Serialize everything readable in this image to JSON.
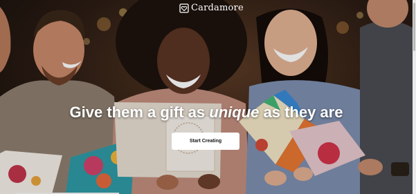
{
  "brand": {
    "name": "Cardamore",
    "logo_icon": "heart-card-icon"
  },
  "hero": {
    "headline_before": "Give them a gift as ",
    "headline_emphasis": "unique",
    "headline_after": " as they are",
    "cta_label": "Start Creating"
  },
  "colors": {
    "cta_background": "#ffffff",
    "headline": "#ffffff"
  }
}
